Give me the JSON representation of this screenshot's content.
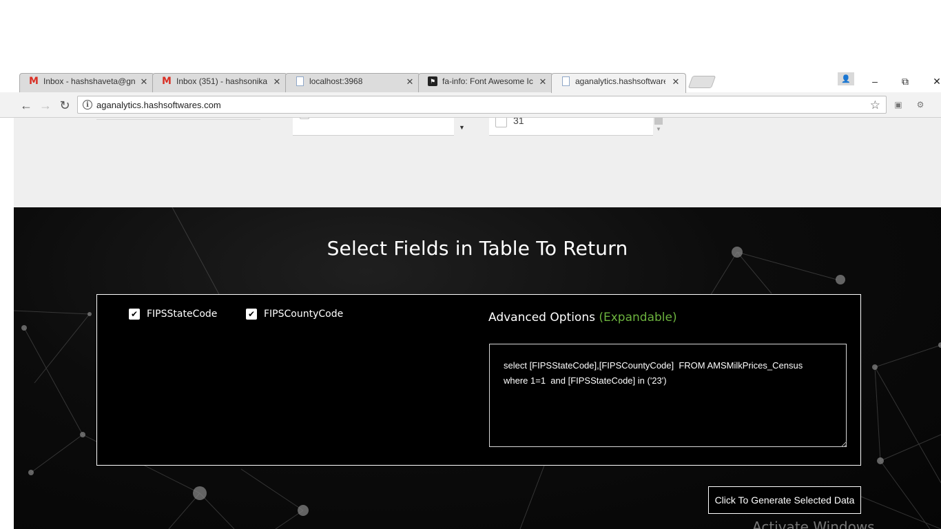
{
  "browser": {
    "tabs": [
      {
        "title": "Inbox - hashshaveta@gn",
        "icon": "gmail-icon",
        "active": false
      },
      {
        "title": "Inbox (351) - hashsonika",
        "icon": "gmail-icon",
        "active": false
      },
      {
        "title": "localhost:3968",
        "icon": "document-icon",
        "active": false
      },
      {
        "title": "fa-info: Font Awesome Ic",
        "icon": "flag-icon",
        "active": false
      },
      {
        "title": "aganalytics.hashsoftware",
        "icon": "document-icon",
        "active": true
      }
    ],
    "tab_close_glyph": "✕",
    "url": "aganalytics.hashsoftwares.com",
    "window_controls": {
      "minimize": "–",
      "restore": "⧉",
      "close": "✕"
    }
  },
  "page": {
    "fragment_list_value": "31",
    "section_title": "Select Fields in Table To Return",
    "fields": [
      {
        "label": "FIPSStateCode",
        "checked": true
      },
      {
        "label": "FIPSCountyCode",
        "checked": true
      }
    ],
    "advanced": {
      "title": "Advanced Options",
      "expand_hint": "(Expandable)",
      "query": "select [FIPSStateCode],[FIPSCountyCode]  FROM AMSMilkPrices_Census \nwhere 1=1  and [FIPSStateCode] in ('23')"
    },
    "generate_button": "Click To Generate Selected Data",
    "watermark": "Activate Windows"
  },
  "colors": {
    "accent_green": "#6cb33e",
    "dark_bg": "#050505",
    "light_band": "#efefef"
  }
}
